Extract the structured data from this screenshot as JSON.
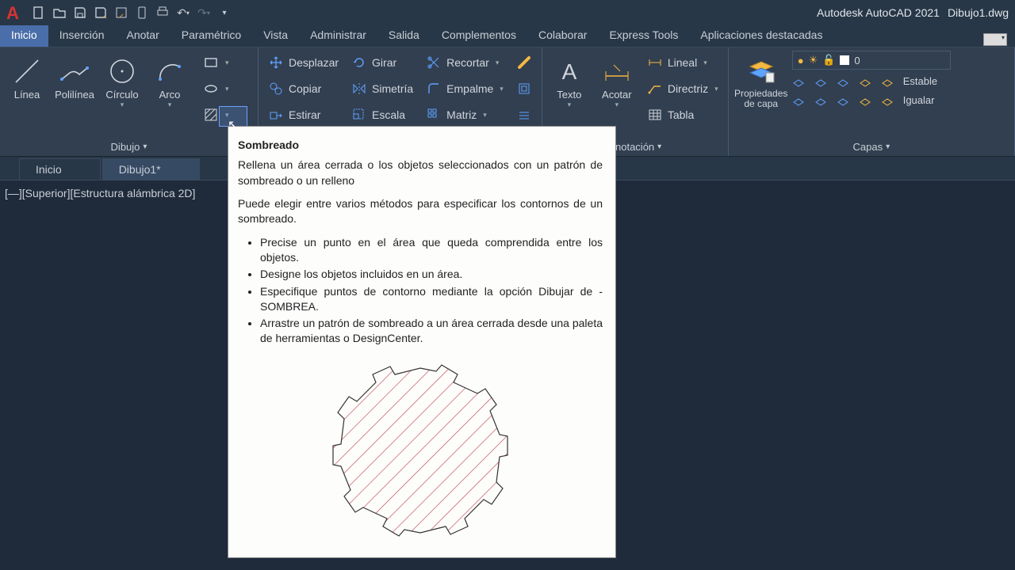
{
  "titlebar": {
    "app_title": "Autodesk AutoCAD 2021",
    "file_name": "Dibujo1.dwg"
  },
  "menu": {
    "items": [
      "Inicio",
      "Inserción",
      "Anotar",
      "Paramétrico",
      "Vista",
      "Administrar",
      "Salida",
      "Complementos",
      "Colaborar",
      "Express Tools",
      "Aplicaciones destacadas"
    ],
    "active": 0
  },
  "ribbon": {
    "dibujo": {
      "title": "Dibujo",
      "linea": "Línea",
      "polilinea": "Polilínea",
      "circulo": "Círculo",
      "arco": "Arco"
    },
    "modificar": {
      "desplazar": "Desplazar",
      "girar": "Girar",
      "recortar": "Recortar",
      "copiar": "Copiar",
      "simetria": "Simetría",
      "empalme": "Empalme",
      "estirar": "Estirar",
      "escala": "Escala",
      "matriz": "Matriz"
    },
    "anotacion": {
      "title": "Anotación",
      "texto": "Texto",
      "acotar": "Acotar",
      "lineal": "Lineal",
      "directriz": "Directriz",
      "tabla": "Tabla"
    },
    "capas": {
      "title": "Capas",
      "propiedades": "Propiedades de capa",
      "establecer": "Estable",
      "igualar": "Igualar",
      "zero": "0"
    }
  },
  "tabs": {
    "inicio": "Inicio",
    "dibujo": "Dibujo1*"
  },
  "viewport_label": "[—][Superior][Estructura alámbrica 2D]",
  "tooltip": {
    "title": "Sombreado",
    "p1": "Rellena un área cerrada o los objetos seleccionados con un patrón de sombreado o un relleno",
    "p2": "Puede elegir entre varios métodos para especificar los contornos de un sombreado.",
    "li1": "Precise un punto en el área que queda comprendida entre los objetos.",
    "li2": "Designe los objetos incluidos en un área.",
    "li3": "Especifique puntos de contorno mediante la opción Dibujar de -SOMBREA.",
    "li4": "Arrastre un patrón de sombreado a un área cerrada desde una paleta de herramientas o DesignCenter."
  }
}
